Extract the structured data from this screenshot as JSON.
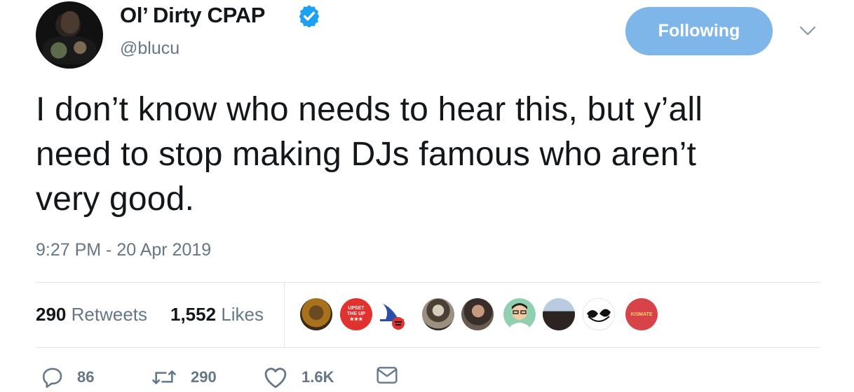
{
  "author": {
    "name": "Ol’ Dirty CPAP",
    "handle": "@blucu",
    "verified": true,
    "avatar_icon": "profile-photo"
  },
  "follow_button": {
    "label": "Following",
    "color": "#7fb6ea"
  },
  "tweet": {
    "text": "I don’t know who needs to hear this, but y’all\nneed to stop making DJs famous who aren’t\nvery good.",
    "timestamp": "9:27 PM - 20 Apr 2019"
  },
  "stats": {
    "retweets_count": "290",
    "retweets_label": "Retweets",
    "likes_count": "1,552",
    "likes_label": "Likes"
  },
  "liked_by_avatars": [
    "avatar-photo-1",
    "upset-the-up-logo",
    "witch-hat-logo",
    "avatar-photo-2",
    "avatar-photo-3",
    "cartoon-avatar",
    "avatar-photo-4",
    "sunglasses-avatar",
    "red-logo-avatar"
  ],
  "upset_logo_text": "UPSET THE UP",
  "red_logo_text": "KISMATE",
  "actions": {
    "reply_count": "86",
    "retweet_count": "290",
    "like_count": "1.6K"
  },
  "colors": {
    "text": "#14171a",
    "secondary": "#657786",
    "verified_blue": "#1da1f2",
    "divider": "#e1e8ed"
  }
}
